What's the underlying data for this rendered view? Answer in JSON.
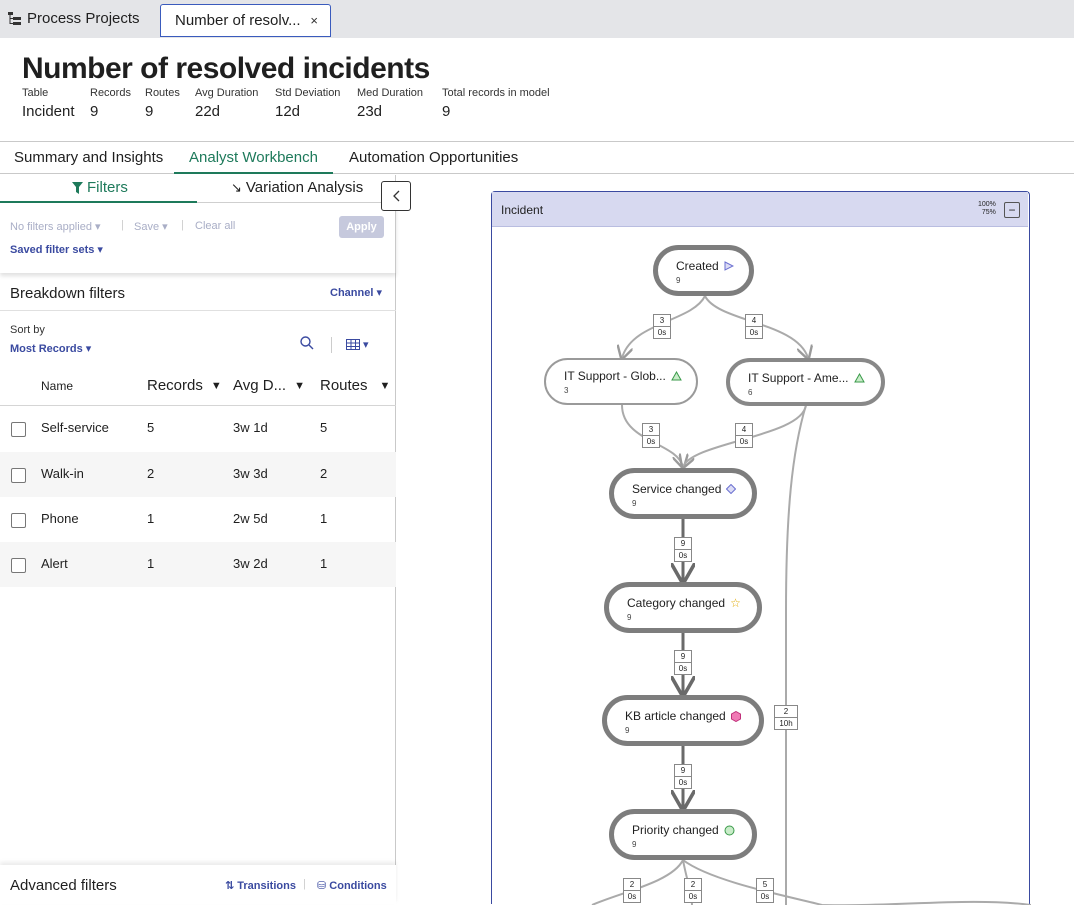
{
  "tabs": {
    "home": "Process Projects",
    "active": "Number of resolv...",
    "close": "×"
  },
  "header": {
    "title": "Number of resolved incidents",
    "stats": [
      {
        "label": "Table",
        "value": "Incident"
      },
      {
        "label": "Records",
        "value": "9"
      },
      {
        "label": "Routes",
        "value": "9"
      },
      {
        "label": "Avg Duration",
        "value": "22d"
      },
      {
        "label": "Std Deviation",
        "value": "12d"
      },
      {
        "label": "Med Duration",
        "value": "23d"
      },
      {
        "label": "Total records in model",
        "value": "9"
      }
    ]
  },
  "section_tabs": [
    "Summary and Insights",
    "Analyst Workbench",
    "Automation Opportunities"
  ],
  "left": {
    "subtabs": [
      "Filters",
      "Variation Analysis"
    ],
    "filter_bar": {
      "no_filters": "No filters applied",
      "save": "Save",
      "clear": "Clear all",
      "apply": "Apply",
      "saved_sets": "Saved filter sets"
    },
    "breakdown": {
      "title": "Breakdown filters",
      "channel": "Channel"
    },
    "sort": {
      "label": "Sort by",
      "value": "Most Records"
    },
    "columns": [
      "Name",
      "Records",
      "Avg D...",
      "Routes"
    ],
    "rows": [
      {
        "name": "Self-service",
        "records": "5",
        "avg": "3w 1d",
        "routes": "5"
      },
      {
        "name": "Walk-in",
        "records": "2",
        "avg": "3w 3d",
        "routes": "2"
      },
      {
        "name": "Phone",
        "records": "1",
        "avg": "2w 5d",
        "routes": "1"
      },
      {
        "name": "Alert",
        "records": "1",
        "avg": "3w 2d",
        "routes": "1"
      }
    ],
    "advanced": {
      "title": "Advanced filters",
      "transitions": "Transitions",
      "conditions": "Conditions"
    }
  },
  "canvas": {
    "title": "Incident",
    "zoom_top": "100%",
    "zoom_bottom": "75%",
    "nodes": [
      {
        "label": "Created",
        "count": "9",
        "icon": "play-triangle-icon"
      },
      {
        "label": "IT Support - Glob...",
        "count": "3",
        "icon": "green-triangle-icon"
      },
      {
        "label": "IT Support - Ame...",
        "count": "6",
        "icon": "green-triangle-icon"
      },
      {
        "label": "Service changed",
        "count": "9",
        "icon": "blue-diamond-icon"
      },
      {
        "label": "Category changed",
        "count": "9",
        "icon": "yellow-star-icon"
      },
      {
        "label": "KB article changed",
        "count": "9",
        "icon": "pink-hexagon-icon"
      },
      {
        "label": "Priority changed",
        "count": "9",
        "icon": "green-circle-icon"
      }
    ],
    "edges": [
      {
        "count": "3",
        "duration": "0s"
      },
      {
        "count": "4",
        "duration": "0s"
      },
      {
        "count": "3",
        "duration": "0s"
      },
      {
        "count": "4",
        "duration": "0s"
      },
      {
        "count": "9",
        "duration": "0s"
      },
      {
        "count": "9",
        "duration": "0s"
      },
      {
        "count": "2",
        "duration": "10h"
      },
      {
        "count": "9",
        "duration": "0s"
      },
      {
        "count": "2",
        "duration": "0s"
      },
      {
        "count": "2",
        "duration": "0s"
      },
      {
        "count": "5",
        "duration": "0s"
      }
    ]
  },
  "colors": {
    "accent_green": "#1e7a5b",
    "link_blue": "#3a4aa0",
    "canvas_header": "#d7d9f0"
  }
}
